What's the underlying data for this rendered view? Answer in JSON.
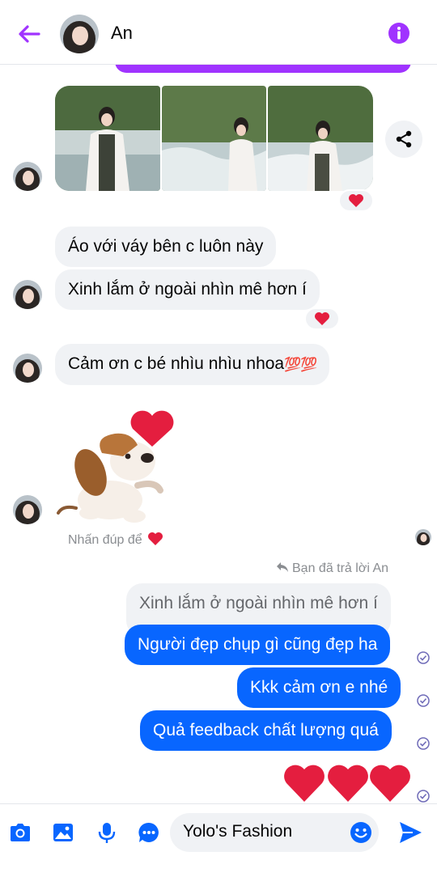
{
  "header": {
    "contact_name": "An"
  },
  "messages": {
    "in_1": "Áo với váy bên c luôn này",
    "in_2": "Xinh lắm ở ngoài nhìn mê hơn í",
    "in_3_text": "Cảm ơn c bé nhìu nhìu nhoa",
    "in_3_emoji": "💯💯",
    "double_tap_text": "Nhấn đúp để",
    "reply_label": "Bạn đã trả lời An",
    "quoted": "Xinh lắm ở ngoài nhìn mê hơn í",
    "out_1": "Người đẹp chụp gì cũng đẹp ha",
    "out_2": "Kkk cảm ơn e nhé",
    "out_3": "Quả feedback chất lượng quá"
  },
  "composer": {
    "input_value": "Yolo's Fashion"
  },
  "colors": {
    "accent_purple": "#a033ff",
    "out_bubble": "#0866ff",
    "in_bubble": "#f0f2f5",
    "heart": "#e41e3f",
    "icon_blue": "#0866ff"
  },
  "icons": [
    "back-arrow-icon",
    "info-icon",
    "share-icon",
    "heart-icon",
    "reply-icon",
    "check-icon",
    "camera-icon",
    "photo-icon",
    "microphone-icon",
    "messenger-apps-icon",
    "emoji-icon",
    "send-icon"
  ]
}
